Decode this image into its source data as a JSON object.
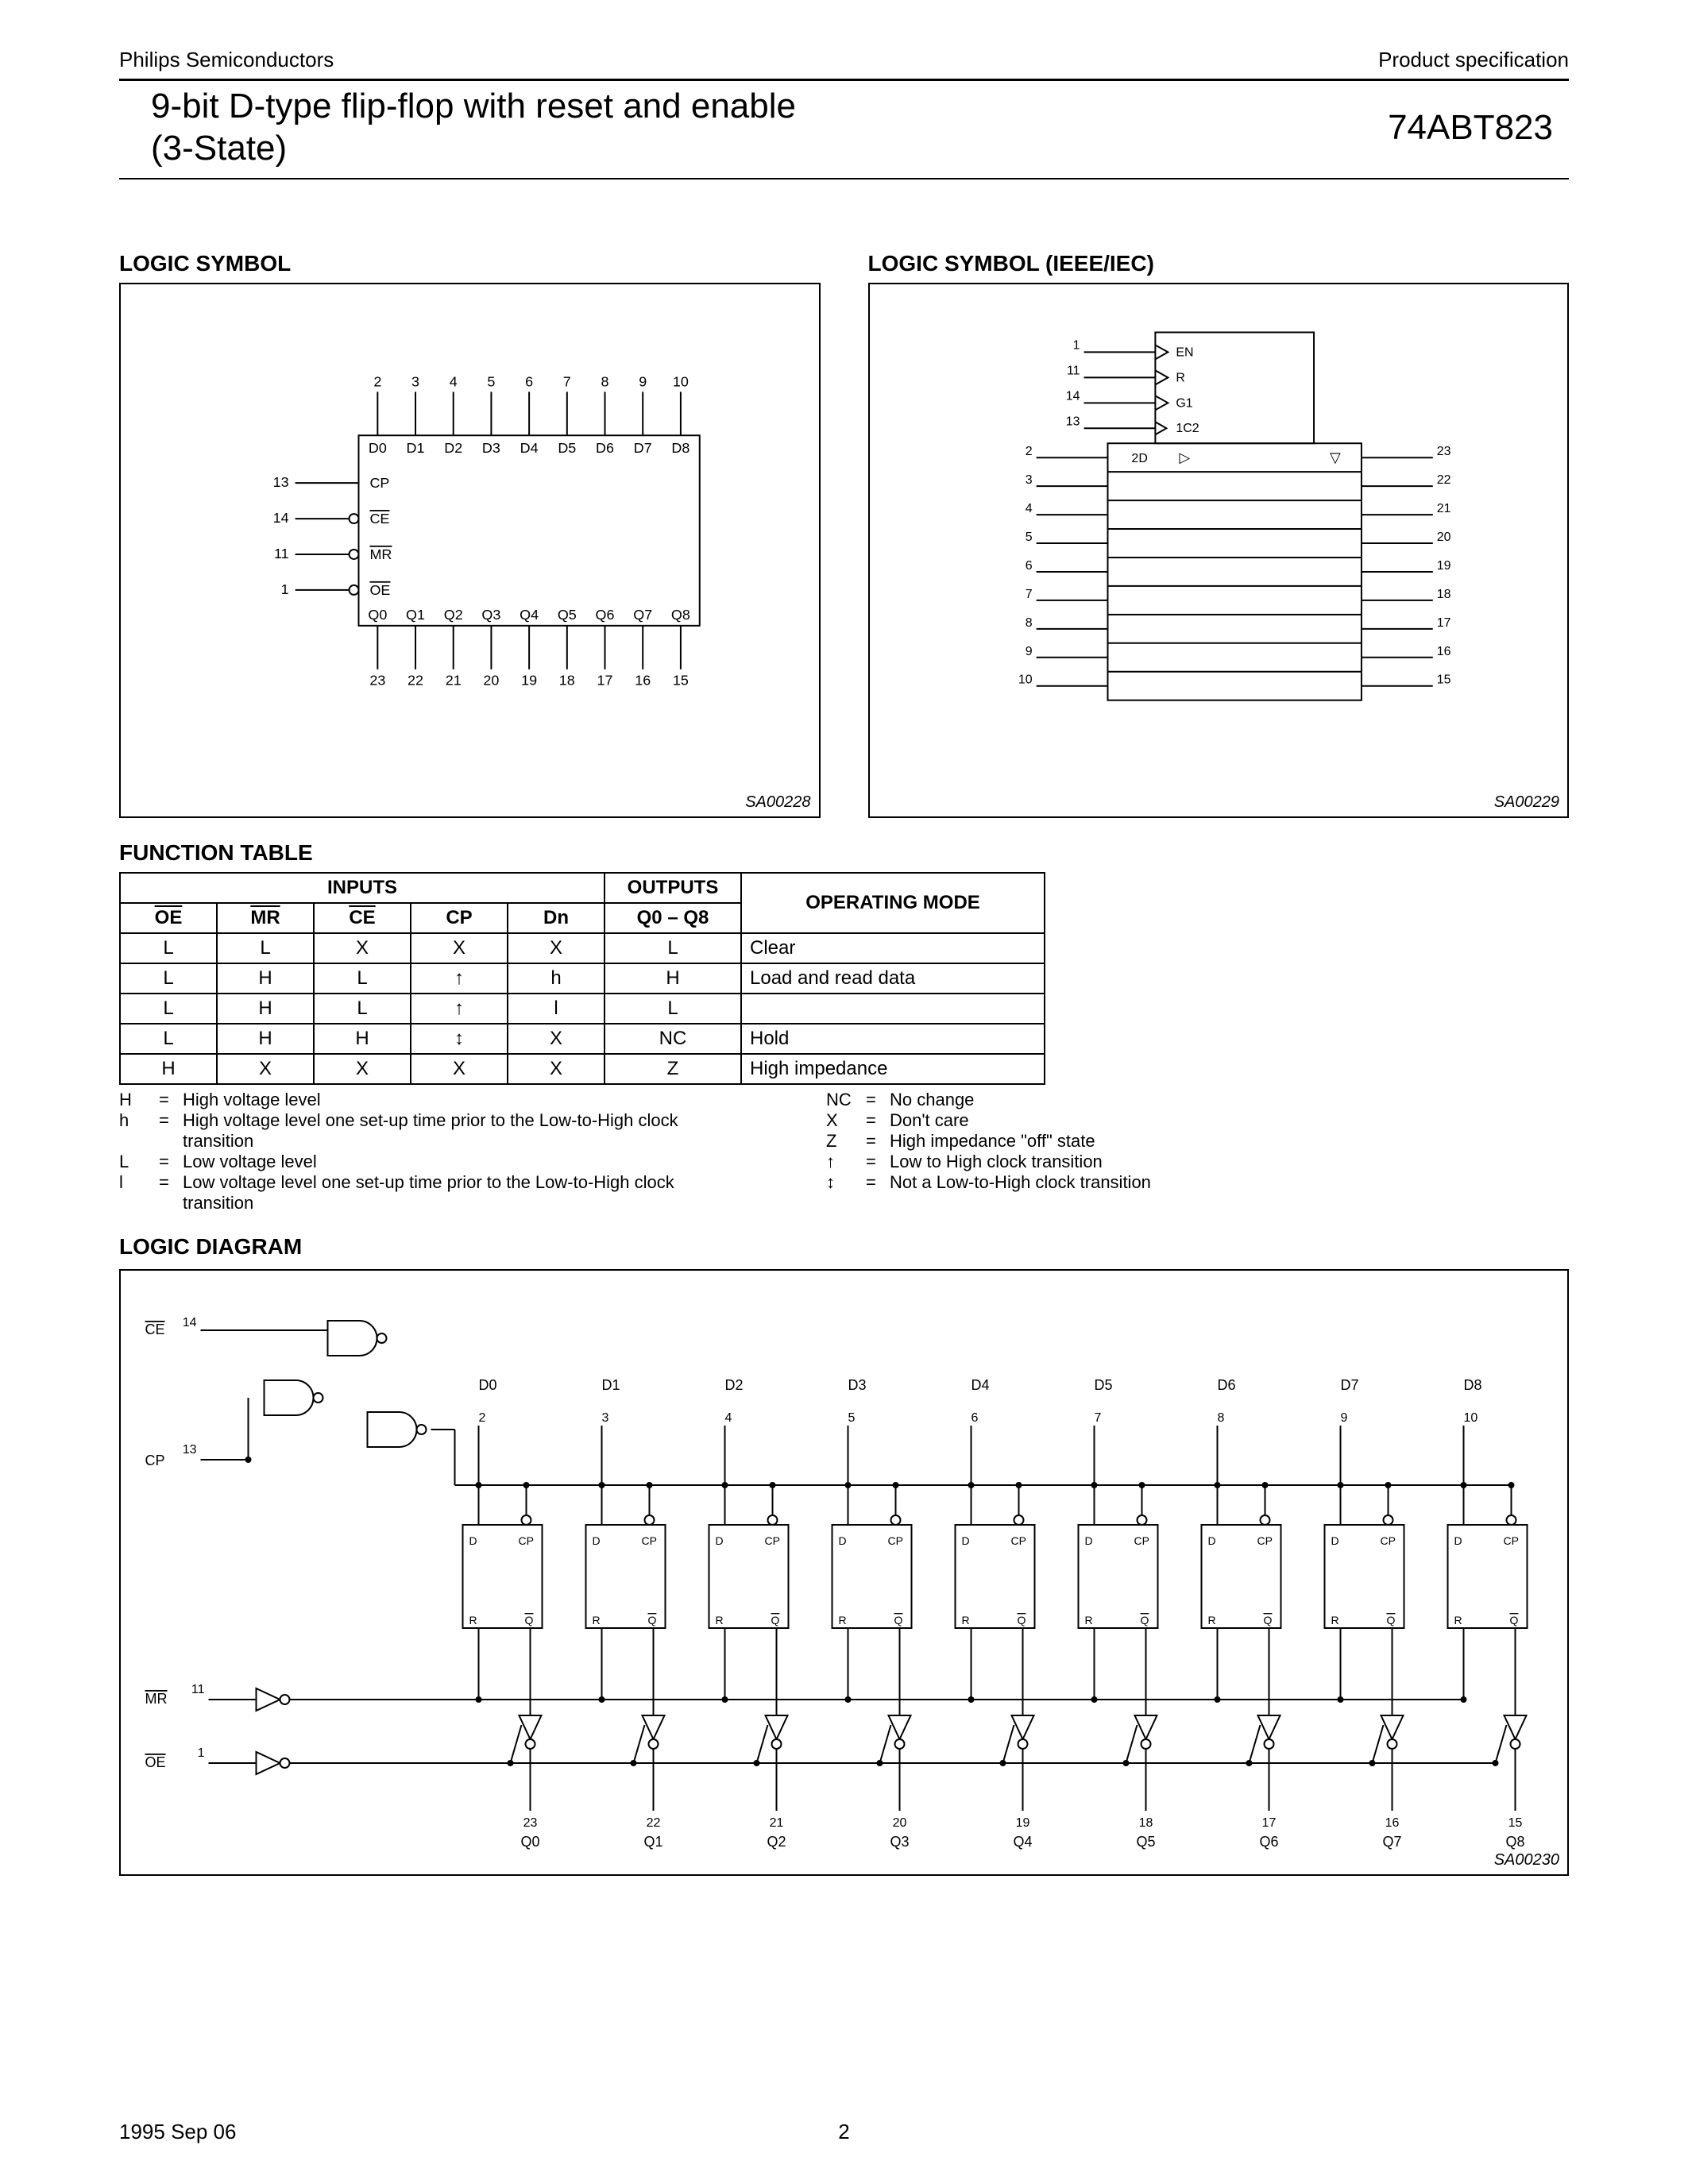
{
  "header": {
    "left": "Philips Semiconductors",
    "right": "Product specification",
    "title_l1": "9-bit D-type flip-flop with reset and enable",
    "title_l2": "(3-State)",
    "part": "74ABT823"
  },
  "sections": {
    "logic_symbol": "LOGIC SYMBOL",
    "logic_symbol_ieee": "LOGIC SYMBOL (IEEE/IEC)",
    "function_table": "FUNCTION TABLE",
    "logic_diagram": "LOGIC DIAGRAM"
  },
  "logic_symbol": {
    "tag": "SA00228",
    "top_pins": [
      "2",
      "3",
      "4",
      "5",
      "6",
      "7",
      "8",
      "9",
      "10"
    ],
    "top_labels": [
      "D0",
      "D1",
      "D2",
      "D3",
      "D4",
      "D5",
      "D6",
      "D7",
      "D8"
    ],
    "bot_labels": [
      "Q0",
      "Q1",
      "Q2",
      "Q3",
      "Q4",
      "Q5",
      "Q6",
      "Q7",
      "Q8"
    ],
    "bot_pins": [
      "23",
      "22",
      "21",
      "20",
      "19",
      "18",
      "17",
      "16",
      "15"
    ],
    "side": [
      {
        "pin": "13",
        "label": "CP",
        "bubble": false
      },
      {
        "pin": "14",
        "label": "CE",
        "bubble": true
      },
      {
        "pin": "11",
        "label": "MR",
        "bubble": true
      },
      {
        "pin": "1",
        "label": "OE",
        "bubble": true
      }
    ]
  },
  "ieee_symbol": {
    "tag": "SA00229",
    "common": [
      {
        "pin": "1",
        "label": "EN",
        "neg": true
      },
      {
        "pin": "11",
        "label": "R",
        "neg": true
      },
      {
        "pin": "14",
        "label": "G1",
        "neg": true
      },
      {
        "pin": "13",
        "label": "1C2",
        "neg": false,
        "clk": true
      }
    ],
    "array_label": "2D",
    "left_pins": [
      "2",
      "3",
      "4",
      "5",
      "6",
      "7",
      "8",
      "9",
      "10"
    ],
    "right_pins": [
      "23",
      "22",
      "21",
      "20",
      "19",
      "18",
      "17",
      "16",
      "15"
    ]
  },
  "function_table": {
    "group_headers": [
      "INPUTS",
      "OUTPUTS",
      "OPERATING MODE"
    ],
    "headers": [
      "OE",
      "MR",
      "CE",
      "CP",
      "Dn",
      "Q0 – Q8",
      ""
    ],
    "overline": [
      true,
      true,
      true,
      false,
      false,
      false,
      false
    ],
    "rows": [
      [
        "L",
        "L",
        "X",
        "X",
        "X",
        "L",
        "Clear"
      ],
      [
        "L",
        "H",
        "L",
        "↑",
        "h",
        "H",
        "Load and read data"
      ],
      [
        "L",
        "H",
        "L",
        "↑",
        "l",
        "L",
        ""
      ],
      [
        "L",
        "H",
        "H",
        "↕",
        "X",
        "NC",
        "Hold"
      ],
      [
        "H",
        "X",
        "X",
        "X",
        "X",
        "Z",
        "High impedance"
      ]
    ]
  },
  "legend": {
    "left": [
      {
        "s": "H",
        "t": "High voltage level"
      },
      {
        "s": "h",
        "t": "High voltage level one set-up time prior to the Low-to-High clock transition"
      },
      {
        "s": "L",
        "t": "Low voltage level"
      },
      {
        "s": "l",
        "t": "Low voltage level one set-up time prior to the Low-to-High clock transition"
      }
    ],
    "right": [
      {
        "s": "NC",
        "t": "No change"
      },
      {
        "s": "X",
        "t": "Don't care"
      },
      {
        "s": "Z",
        "t": "High impedance \"off\" state"
      },
      {
        "s": "↑",
        "t": "Low to High clock transition"
      },
      {
        "s": "↕",
        "t": "Not a Low-to-High clock transition"
      }
    ]
  },
  "logic_diagram": {
    "tag": "SA00230",
    "inputs": {
      "ce": "CE",
      "ce_pin": "14",
      "cp": "CP",
      "cp_pin": "13",
      "mr": "MR",
      "mr_pin": "11",
      "oe": "OE",
      "oe_pin": "1"
    },
    "ff_internal": {
      "d": "D",
      "cp": "CP",
      "r": "R",
      "q": "Q"
    },
    "d_labels": [
      "D0",
      "D1",
      "D2",
      "D3",
      "D4",
      "D5",
      "D6",
      "D7",
      "D8"
    ],
    "d_pins": [
      "2",
      "3",
      "4",
      "5",
      "6",
      "7",
      "8",
      "9",
      "10"
    ],
    "q_labels": [
      "Q0",
      "Q1",
      "Q2",
      "Q3",
      "Q4",
      "Q5",
      "Q6",
      "Q7",
      "Q8"
    ],
    "q_pins": [
      "23",
      "22",
      "21",
      "20",
      "19",
      "18",
      "17",
      "16",
      "15"
    ]
  },
  "footer": {
    "date": "1995 Sep 06",
    "page": "2"
  }
}
